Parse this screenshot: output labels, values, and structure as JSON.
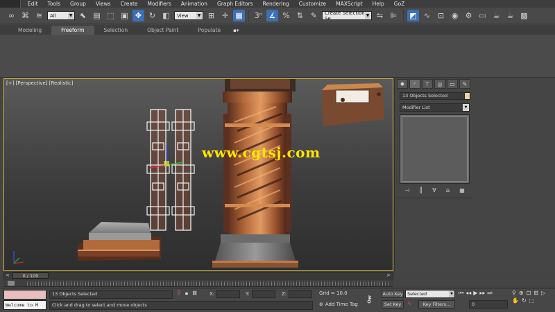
{
  "menubar": {
    "items": [
      "Edit",
      "Tools",
      "Group",
      "Views",
      "Create",
      "Modifiers",
      "Animation",
      "Graph Editors",
      "Rendering",
      "Customize",
      "MAXScript",
      "Help",
      "GoZ"
    ]
  },
  "toolbar": {
    "filter_value": "All",
    "ref_coord_value": "View",
    "named_selection_value": "Create Selection Se",
    "snap_label": "3"
  },
  "ribbon": {
    "tabs": [
      "Modeling",
      "Freeform",
      "Selection",
      "Object Paint",
      "Populate"
    ],
    "active_tab": "Freeform",
    "menu_glyph": "▪▾"
  },
  "viewport": {
    "label": "[+] [Perspective] [Realistic]",
    "watermark": "www.cgtsj.com"
  },
  "command_panel": {
    "tabs": [
      "create-icon",
      "modify-icon",
      "hierarchy-icon",
      "motion-icon",
      "display-icon",
      "utilities-icon"
    ],
    "name_field": "13 Objects Selected",
    "modifier_list": "Modifier List",
    "swatch_color": "#e9d6a4"
  },
  "timeline": {
    "frame_readout": "0 / 100"
  },
  "status": {
    "listener_text": "Welcome to M",
    "selection_text": "13 Objects Selected",
    "prompt_text": "Click and drag to select and move objects",
    "x_label": "X:",
    "y_label": "Y:",
    "z_label": "Z:",
    "grid_text": "Grid = 10.0",
    "add_time_tag": "Add Time Tag",
    "auto_key": "Auto Key",
    "set_key": "Set Key",
    "selected_combo": "Selected",
    "key_filters": "Key Filters...",
    "frame_value": "0"
  },
  "colors": {
    "viewport_border": "#d2b33a",
    "watermark": "#ffe600",
    "active_tool": "#3b6fb6",
    "listener_bg": "#e8bebe"
  }
}
